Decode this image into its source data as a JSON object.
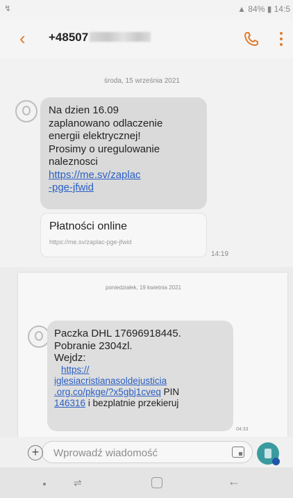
{
  "status_bar": {
    "left_icon": "notification-icon",
    "right_text": "84% ▮ 14:5",
    "signal_icon": "signal-icon"
  },
  "app_bar": {
    "back_icon": "back-arrow-icon",
    "contact_visible": "+48507",
    "call_icon": "phone-icon",
    "menu_icon": "more-vert-icon",
    "accent_color": "#e07b2a"
  },
  "conversation_1": {
    "date": "środa, 15 września 2021",
    "message_lines": [
      "Na dzien 16.09",
      "zaplanowano odlaczenie",
      "energii elektrycznej!",
      "Prosimy o uregulowanie",
      "naleznosci"
    ],
    "link_lines": [
      "https://me.sv/zaplac",
      "-pge-jfwid"
    ],
    "preview_title": "Płatności online",
    "preview_url": "https://me.sv/zaplac-pge-jfwid",
    "time": "14:19"
  },
  "conversation_2": {
    "date": "poniedziałek, 19 kwietnia 2021",
    "message_lines": [
      "Paczka DHL 17696918445.",
      "Pobranie 2304zl.",
      "Wejdz:"
    ],
    "link_lines": [
      "https://",
      "iglesiacristianasoldejusticia",
      ".org.co/pkge/?x5gbj1cveq"
    ],
    "pin_label": "PIN",
    "pin_code": "146316",
    "tail_text": "i bezplatnie przekieruj",
    "time": "04:33"
  },
  "composer": {
    "placeholder": "Wprowadź wiadomość",
    "add_icon": "plus-circle-icon",
    "sticker_icon": "sticker-icon",
    "send_icon": "send-icon",
    "send_color": "#3a9b9f"
  },
  "nav_bar": {
    "icons": [
      "nav-dot-icon",
      "recent-apps-icon",
      "home-icon",
      "back-icon"
    ]
  }
}
